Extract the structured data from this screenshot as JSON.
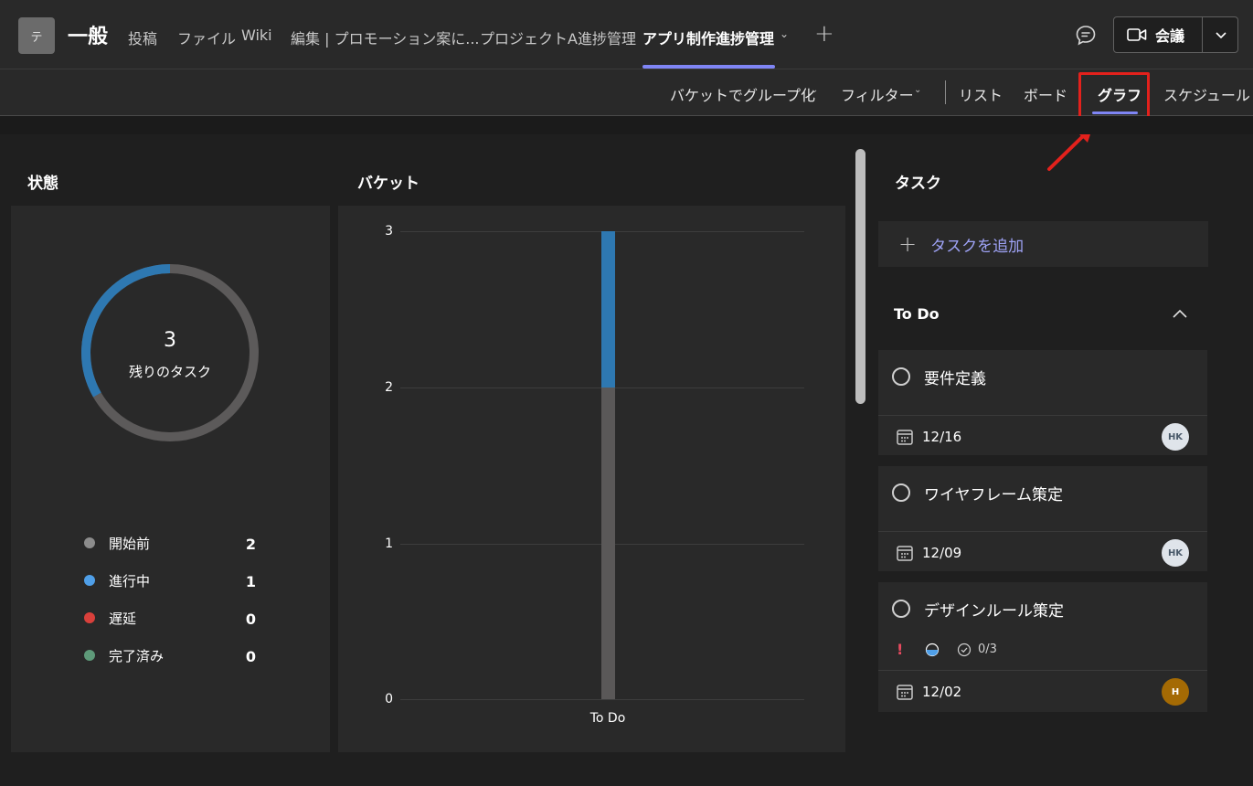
{
  "header": {
    "team_avatar_letter": "テ",
    "channel_name": "一般",
    "tabs": [
      {
        "label": "投稿"
      },
      {
        "label": "ファイル"
      },
      {
        "label": "Wiki"
      },
      {
        "label": "編集 | プロモーション案に..."
      },
      {
        "label": "プロジェクトA進捗管理"
      },
      {
        "label": "アプリ制作進捗管理"
      }
    ],
    "meet_label": "会議"
  },
  "toolbar": {
    "group_by": "バケットでグループ化",
    "filter": "フィルター",
    "views": [
      "リスト",
      "ボード",
      "グラフ",
      "スケジュール"
    ]
  },
  "status": {
    "title": "状態",
    "remaining_count": "3",
    "remaining_label": "残りのタスク",
    "legend": [
      {
        "label": "開始前",
        "value": "2",
        "color": "#8c8c8c"
      },
      {
        "label": "進行中",
        "value": "1",
        "color": "#4f9fe8"
      },
      {
        "label": "遅延",
        "value": "0",
        "color": "#d9403b"
      },
      {
        "label": "完了済み",
        "value": "0",
        "color": "#5e9a79"
      }
    ],
    "donut_colors": {
      "not_started": "#5c5a5a",
      "in_progress": "#2e78b1"
    }
  },
  "bucket": {
    "title": "バケット"
  },
  "chart_data": {
    "type": "bar",
    "stacked": true,
    "categories": [
      "To Do"
    ],
    "series": [
      {
        "name": "開始前",
        "values": [
          2
        ],
        "color": "#5a5858"
      },
      {
        "name": "進行中",
        "values": [
          1
        ],
        "color": "#2e78b1"
      }
    ],
    "yticks": [
      "0",
      "1",
      "2",
      "3"
    ],
    "ylim": [
      0,
      3
    ],
    "grid": true
  },
  "tasks": {
    "title": "タスク",
    "add_label": "タスクを追加",
    "group_name": "To Do",
    "items": [
      {
        "title": "要件定義",
        "due": "12/16",
        "assignee": "HK"
      },
      {
        "title": "ワイヤフレーム策定",
        "due": "12/09",
        "assignee": "HK"
      },
      {
        "title": "デザインルール策定",
        "due": "12/02",
        "assignee": "H",
        "checklist": "0/3",
        "priority_mark": "!"
      }
    ]
  }
}
